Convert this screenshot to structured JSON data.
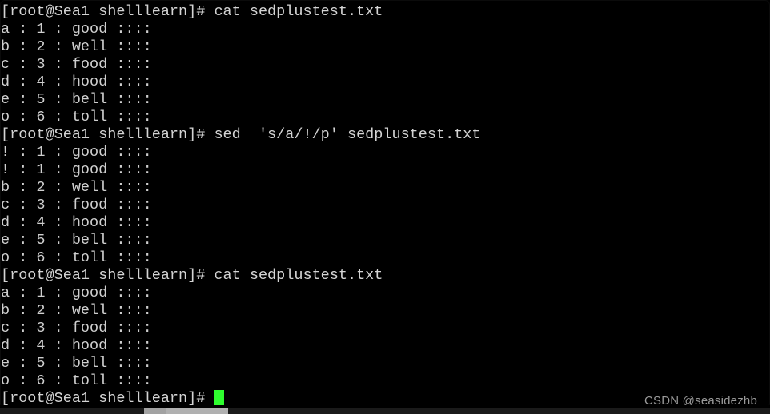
{
  "window": {
    "title": "Terminal",
    "background_color": "#000000",
    "foreground_color": "#cfcfcf",
    "cursor_color": "#2efc2e"
  },
  "terminal": {
    "prompt": "[root@Sea1 shelllearn]#",
    "lines": [
      {
        "type": "command",
        "text": "[root@Sea1 shelllearn]# cat sedplustest.txt"
      },
      {
        "type": "output",
        "text": "a : 1 : good ::::"
      },
      {
        "type": "output",
        "text": "b : 2 : well ::::"
      },
      {
        "type": "output",
        "text": "c : 3 : food ::::"
      },
      {
        "type": "output",
        "text": "d : 4 : hood ::::"
      },
      {
        "type": "output",
        "text": "e : 5 : bell ::::"
      },
      {
        "type": "output",
        "text": "o : 6 : toll ::::"
      },
      {
        "type": "command",
        "text": "[root@Sea1 shelllearn]# sed  's/a/!/p' sedplustest.txt"
      },
      {
        "type": "output",
        "text": "! : 1 : good ::::"
      },
      {
        "type": "output",
        "text": "! : 1 : good ::::"
      },
      {
        "type": "output",
        "text": "b : 2 : well ::::"
      },
      {
        "type": "output",
        "text": "c : 3 : food ::::"
      },
      {
        "type": "output",
        "text": "d : 4 : hood ::::"
      },
      {
        "type": "output",
        "text": "e : 5 : bell ::::"
      },
      {
        "type": "output",
        "text": "o : 6 : toll ::::"
      },
      {
        "type": "command",
        "text": "[root@Sea1 shelllearn]# cat sedplustest.txt"
      },
      {
        "type": "output",
        "text": "a : 1 : good ::::"
      },
      {
        "type": "output",
        "text": "b : 2 : well ::::"
      },
      {
        "type": "output",
        "text": "c : 3 : food ::::"
      },
      {
        "type": "output",
        "text": "d : 4 : hood ::::"
      },
      {
        "type": "output",
        "text": "e : 5 : bell ::::"
      },
      {
        "type": "output",
        "text": "o : 6 : toll ::::"
      }
    ],
    "active_line": {
      "prompt": "[root@Sea1 shelllearn]# ",
      "input_value": "",
      "cursor": "block-cursor"
    },
    "commands_issued": [
      "cat sedplustest.txt",
      "sed  's/a/!/p' sedplustest.txt",
      "cat sedplustest.txt"
    ],
    "file_name": "sedplustest.txt"
  },
  "watermark": {
    "text": "CSDN @seasidezhb"
  },
  "scrollbar": {
    "orientation": "horizontal",
    "thumb_label": "horizontal-scrollbar-thumb"
  }
}
